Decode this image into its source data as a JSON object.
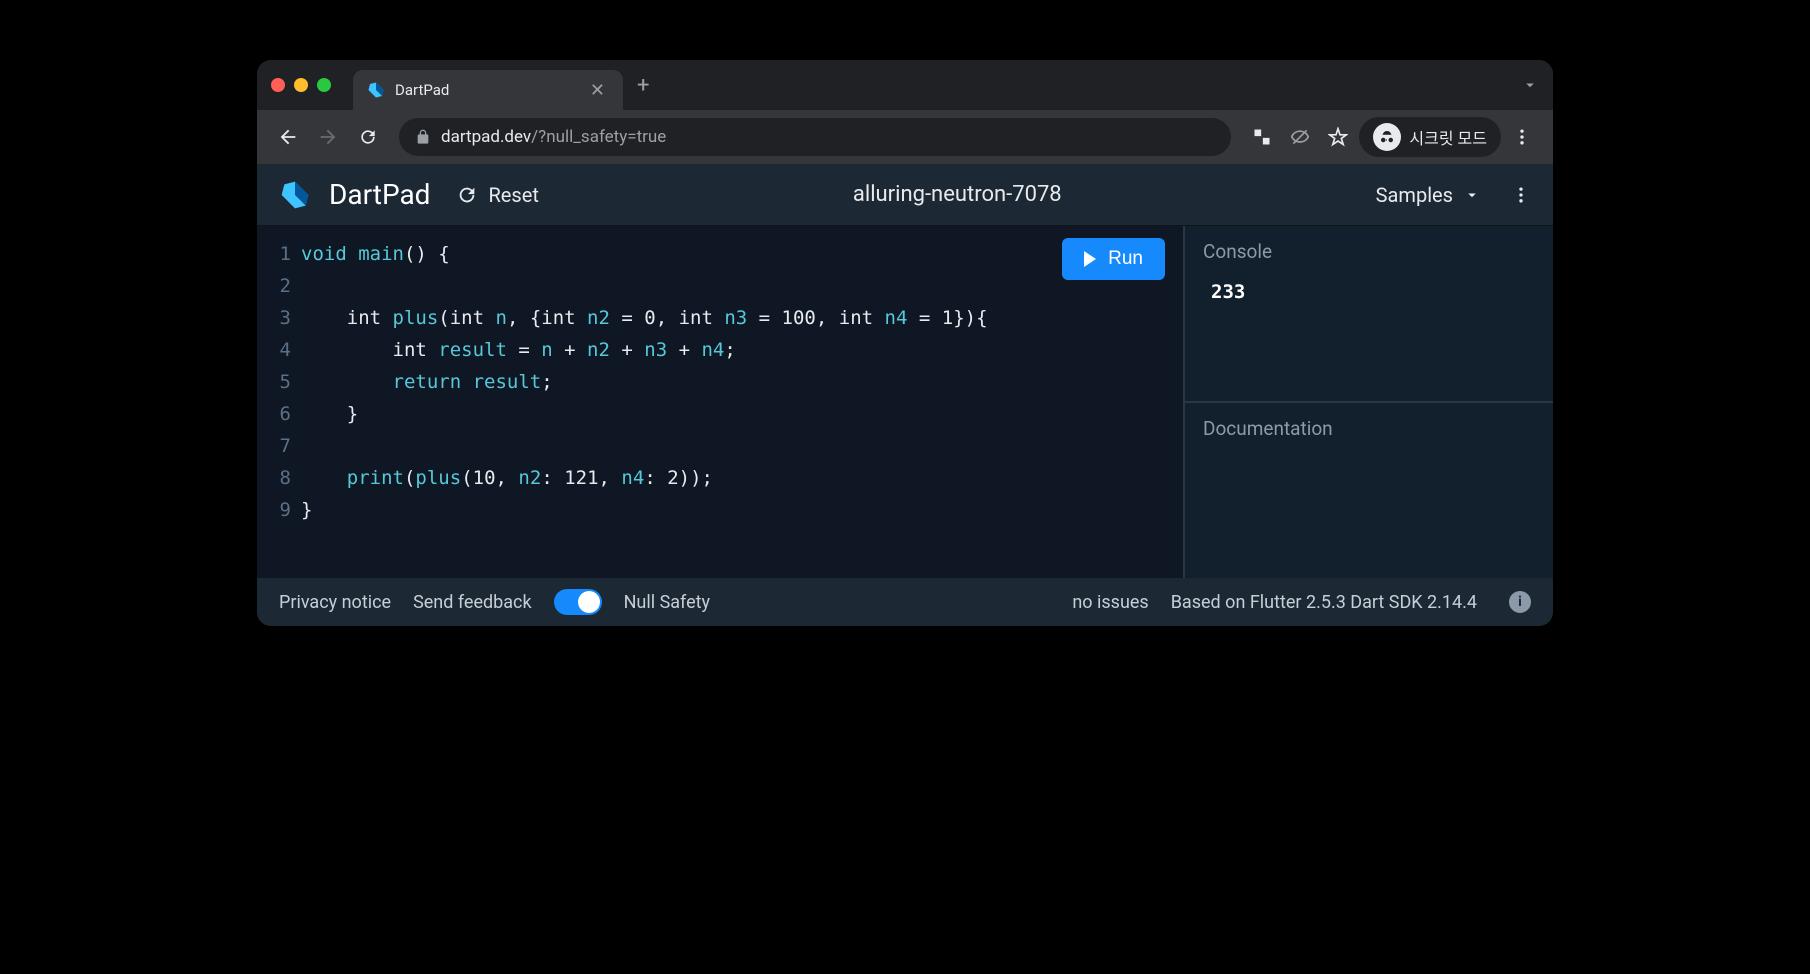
{
  "browser": {
    "tab_title": "DartPad",
    "url_host": "dartpad.dev",
    "url_path": "/?null_safety=true",
    "incognito_label": "시크릿 모드"
  },
  "header": {
    "app_name": "DartPad",
    "reset_label": "Reset",
    "project_name": "alluring-neutron-7078",
    "samples_label": "Samples"
  },
  "editor": {
    "line_numbers": [
      "1",
      "2",
      "3",
      "4",
      "5",
      "6",
      "7",
      "8",
      "9"
    ],
    "run_label": "Run",
    "code": {
      "l1_pre": "void ",
      "l1_main": "main",
      "l1_post": "() {",
      "l2": "",
      "l3_pre": "    int ",
      "l3_plus": "plus",
      "l3_mid1": "(int ",
      "l3_n": "n",
      "l3_mid2": ", {int ",
      "l3_n2": "n2",
      "l3_mid3": " = ",
      "l3_z": "0",
      "l3_mid4": ", int ",
      "l3_n3": "n3",
      "l3_mid5": " = ",
      "l3_h": "100",
      "l3_mid6": ", int ",
      "l3_n4": "n4",
      "l3_mid7": " = ",
      "l3_one": "1",
      "l3_post": "}){",
      "l4_pre": "        int ",
      "l4_res": "result",
      "l4_mid": " = ",
      "l4_na": "n",
      "l4_p1": " + ",
      "l4_nb": "n2",
      "l4_p2": " + ",
      "l4_nc": "n3",
      "l4_p3": " + ",
      "l4_nd": "n4",
      "l4_post": ";",
      "l5_pre": "        ",
      "l5_ret": "return",
      "l5_sp": " ",
      "l5_res": "result",
      "l5_post": ";",
      "l6": "    }",
      "l7": "",
      "l8_pre": "    ",
      "l8_print": "print",
      "l8_op": "(",
      "l8_plus": "plus",
      "l8_a": "(",
      "l8_ten": "10",
      "l8_c1": ", ",
      "l8_n2k": "n2",
      "l8_col1": ": ",
      "l8_v1": "121",
      "l8_c2": ", ",
      "l8_n4k": "n4",
      "l8_col2": ": ",
      "l8_v2": "2",
      "l8_post": "));",
      "l9": "}"
    }
  },
  "side": {
    "console_label": "Console",
    "console_output": "233",
    "documentation_label": "Documentation"
  },
  "footer": {
    "privacy": "Privacy notice",
    "feedback": "Send feedback",
    "null_safety": "Null Safety",
    "issues": "no issues",
    "version": "Based on Flutter 2.5.3 Dart SDK 2.14.4"
  },
  "icons": {
    "close_glyph": "✕",
    "plus_glyph": "+"
  }
}
